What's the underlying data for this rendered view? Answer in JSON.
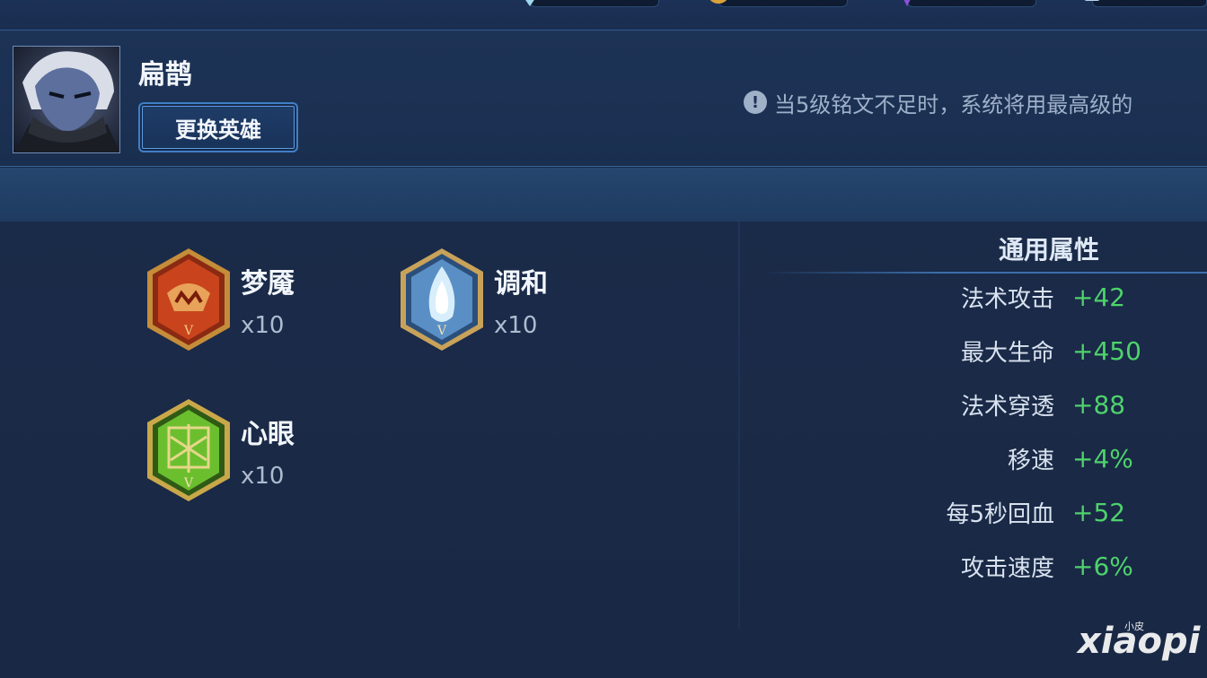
{
  "header": {
    "hero_name": "扁鹊",
    "switch_button": "更换英雄",
    "notice": "当5级铭文不足时，系统将用最高级的"
  },
  "runes": [
    {
      "name": "梦魇",
      "count": "x10",
      "color": "#c9441c"
    },
    {
      "name": "调和",
      "count": "x10",
      "color": "#5a8fc6"
    },
    {
      "name": "心眼",
      "count": "x10",
      "color": "#4f9a2a"
    }
  ],
  "stats": {
    "title": "通用属性",
    "rows": [
      {
        "label": "法术攻击",
        "value": "+42"
      },
      {
        "label": "最大生命",
        "value": "+450"
      },
      {
        "label": "法术穿透",
        "value": "+88"
      },
      {
        "label": "移速",
        "value": "+4%"
      },
      {
        "label": "每5秒回血",
        "value": "+52"
      },
      {
        "label": "攻击速度",
        "value": "+6%"
      }
    ]
  },
  "watermark": {
    "main": "xiaopi",
    "small": "小皮"
  },
  "colors": {
    "positive": "#4ed26b",
    "accent": "#3f7fc6"
  }
}
